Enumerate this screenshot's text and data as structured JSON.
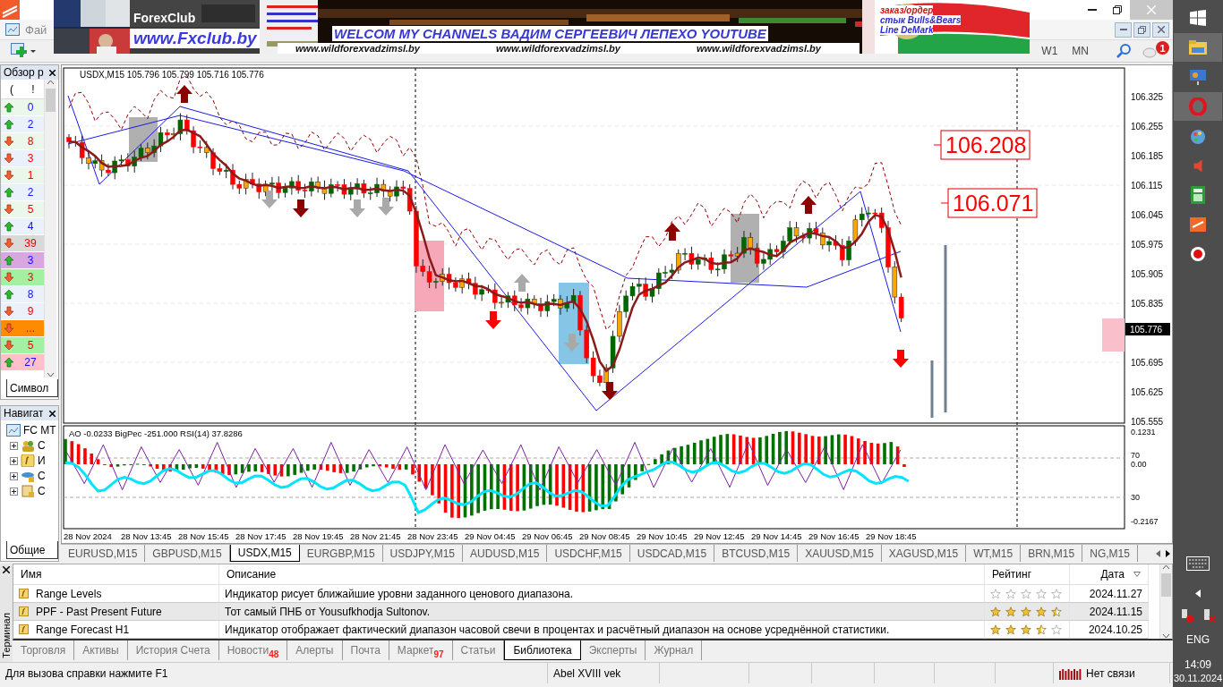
{
  "banner": {
    "brand": "ForexClub",
    "site": "www.Fxclub.by",
    "headline": "WELCOM MY CHANNELS ВАДИМ СЕРГЕЕВИЧ ЛЕПЕХО YOUTUBE",
    "links": [
      "www.wildforexvadzimsl.by",
      "www.wildforexvadzimsl.by",
      "www.wildforexvadzimsl.by"
    ],
    "notes": [
      "заказ/ордер",
      "стык Bulls&Bears",
      "Line DeMark"
    ]
  },
  "menu": [
    "Фай"
  ],
  "toolbar": {
    "periods": [
      "W1",
      "MN"
    ],
    "notification_count": "1"
  },
  "market_watch": {
    "title": "Обзор р",
    "columns": [
      "(",
      "!"
    ],
    "tab": "Символ",
    "rows": [
      {
        "rising": true,
        "value": "0",
        "color": "#eaf7ea"
      },
      {
        "rising": true,
        "value": "2",
        "color": "#eaf1fb"
      },
      {
        "rising": false,
        "value": "8",
        "color": "#eaf7ea"
      },
      {
        "rising": false,
        "value": "3",
        "color": "#eaf1fb"
      },
      {
        "rising": false,
        "value": "1",
        "color": "#eaf7ea"
      },
      {
        "rising": true,
        "value": "2",
        "color": "#eaf1fb"
      },
      {
        "rising": false,
        "value": "5",
        "color": "#eaf7ea"
      },
      {
        "rising": true,
        "value": "4",
        "color": "#eaf1fb"
      },
      {
        "rising": false,
        "value": "39",
        "color": "#d9d9d9"
      },
      {
        "rising": true,
        "value": "3",
        "color": "#d9a6e2"
      },
      {
        "rising": false,
        "value": "3",
        "color": "#a3f0a3"
      },
      {
        "rising": true,
        "value": "8",
        "color": "#eaf1fb"
      },
      {
        "rising": false,
        "value": "9",
        "color": "#eaf1fb"
      },
      {
        "rising": false,
        "value": "...",
        "color": "#ff8c00"
      },
      {
        "rising": false,
        "value": "5",
        "color": "#a3f0a3"
      },
      {
        "rising": true,
        "value": "27",
        "color": "#ffc0cb"
      }
    ]
  },
  "navigator": {
    "title": "Навигат",
    "root": "FC MT",
    "tab": "Общие",
    "children": [
      {
        "label": "С",
        "kind": "accounts",
        "expanded": false
      },
      {
        "label": "И",
        "kind": "indicators",
        "expanded": false
      },
      {
        "label": "С",
        "kind": "experts",
        "expanded": false
      },
      {
        "label": "С",
        "kind": "scripts",
        "expanded": false
      }
    ]
  },
  "chart": {
    "header": "USDX,M15  105.796 105.799 105.716 105.776",
    "price_ticks": [
      "106.325",
      "106.255",
      "106.185",
      "106.115",
      "106.045",
      "105.975",
      "105.905",
      "105.835",
      "105.695",
      "105.625",
      "105.555"
    ],
    "current_price": "105.776",
    "level_labels": [
      "106.208",
      "106.071"
    ],
    "indicator_header": "AO -0.0233  BigPec -251.000  RSI(14) 37.8286",
    "indicator_ticks": [
      "0.1231",
      "70",
      "0.00",
      "30",
      "-0.2167"
    ],
    "time_labels": [
      "28 Nov 2024",
      "28 Nov 13:45",
      "28 Nov 15:45",
      "28 Nov 17:45",
      "28 Nov 19:45",
      "28 Nov 21:45",
      "28 Nov 23:45",
      "29 Nov 04:45",
      "29 Nov 06:45",
      "29 Nov 08:45",
      "29 Nov 10:45",
      "29 Nov 12:45",
      "29 Nov 14:45",
      "29 Nov 16:45",
      "29 Nov 18:45"
    ]
  },
  "chart_tabs": [
    {
      "label": "EURUSD,M15",
      "selected": false
    },
    {
      "label": "GBPUSD,M15",
      "selected": false
    },
    {
      "label": "USDX,M15",
      "selected": true
    },
    {
      "label": "EURGBP,M15",
      "selected": false
    },
    {
      "label": "USDJPY,M15",
      "selected": false
    },
    {
      "label": "AUDUSD,M15",
      "selected": false
    },
    {
      "label": "USDCHF,M15",
      "selected": false
    },
    {
      "label": "USDCAD,M15",
      "selected": false
    },
    {
      "label": "BTCUSD,M15",
      "selected": false
    },
    {
      "label": "XAUUSD,M15",
      "selected": false
    },
    {
      "label": "XAGUSD,M15",
      "selected": false
    },
    {
      "label": "WT,M15",
      "selected": false
    },
    {
      "label": "BRN,M15",
      "selected": false
    },
    {
      "label": "NG,M15",
      "selected": false
    }
  ],
  "terminal": {
    "title": "Терминал",
    "columns": [
      "Имя",
      "Описание",
      "Рейтинг",
      "Дата"
    ],
    "rows": [
      {
        "name": "Range Levels",
        "description": "Индикатор рисует ближайшие уровни заданного ценового диапазона.",
        "stars": 0,
        "date": "2024.11.27",
        "selected": false
      },
      {
        "name": "PPF - Past Present Future",
        "description": "Тот самый ПНБ от Yousufkhodja Sultonov.",
        "stars": 4.5,
        "date": "2024.11.15",
        "selected": true
      },
      {
        "name": "Range Forecast H1",
        "description": "Индикатор отображает фактический диапазон часовой свечи в процентах и расчётный диапазон на основе усреднённой статистики.",
        "stars": 3.5,
        "date": "2024.10.25",
        "selected": false
      }
    ],
    "tabs": [
      {
        "label": "Торговля",
        "selected": false
      },
      {
        "label": "Активы",
        "selected": false
      },
      {
        "label": "История Счета",
        "selected": false
      },
      {
        "label": "Новости",
        "badge": "48",
        "selected": false
      },
      {
        "label": "Алерты",
        "selected": false
      },
      {
        "label": "Почта",
        "selected": false
      },
      {
        "label": "Маркет",
        "badge": "97",
        "selected": false
      },
      {
        "label": "Статьи",
        "selected": false
      },
      {
        "label": "Библиотека",
        "selected": true
      },
      {
        "label": "Эксперты",
        "selected": false
      },
      {
        "label": "Журнал",
        "selected": false
      }
    ]
  },
  "status_bar": {
    "help": "Для вызова справки нажмите F1",
    "profile": "Abel XVIII vek",
    "connection": "Нет связи"
  },
  "taskbar": {
    "language": "ENG",
    "time": "14:09",
    "date": "30.11.2024"
  }
}
